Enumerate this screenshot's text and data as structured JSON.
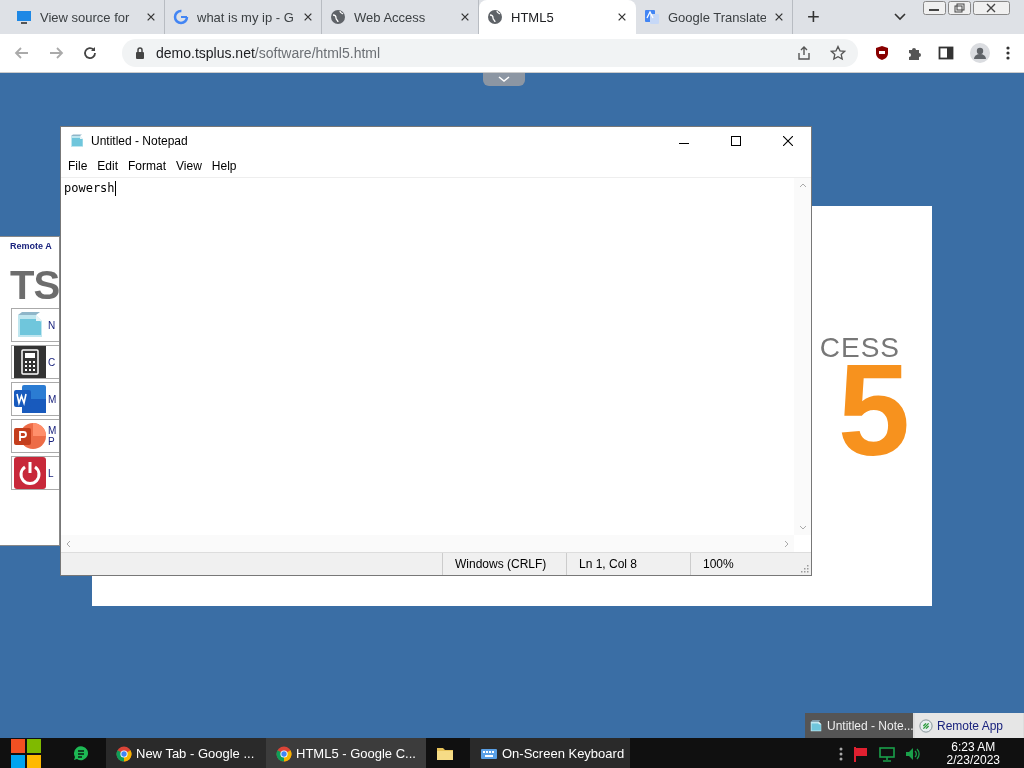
{
  "browser": {
    "tabs": [
      {
        "title": "View source for",
        "selected": false
      },
      {
        "title": "what is my ip - G",
        "selected": false
      },
      {
        "title": "Web Access",
        "selected": false
      },
      {
        "title": "HTML5",
        "selected": true
      },
      {
        "title": "Google Translate",
        "selected": false
      }
    ],
    "new_tab": "+",
    "address": {
      "host": "demo.tsplus.net",
      "path": "/software/html5.html"
    }
  },
  "remote_panel": {
    "title": "Remote A",
    "logo": "TS",
    "apps": [
      {
        "lines": [
          "N"
        ]
      },
      {
        "lines": [
          "C"
        ]
      },
      {
        "lines": [
          "M"
        ]
      },
      {
        "lines": [
          "M",
          "P"
        ]
      },
      {
        "lines": [
          "L"
        ]
      }
    ]
  },
  "background_logo": {
    "word": "CESS",
    "mark": "5"
  },
  "notepad": {
    "title": "Untitled - Notepad",
    "menu": [
      "File",
      "Edit",
      "Format",
      "View",
      "Help"
    ],
    "text": "powersh",
    "status": [
      "Windows (CRLF)",
      "Ln 1, Col 8",
      "100%"
    ]
  },
  "taskbar_popup": [
    {
      "label": "Untitled - Note...",
      "selected": true
    },
    {
      "label": "Remote App",
      "selected": false
    }
  ],
  "taskbar": {
    "items": [
      {
        "kind": "icon"
      },
      {
        "kind": "button",
        "label": "New Tab - Google ...",
        "selected": false
      },
      {
        "kind": "button",
        "label": "HTML5 - Google C...",
        "selected": true
      },
      {
        "kind": "icon"
      },
      {
        "kind": "button",
        "label": "On-Screen Keyboard",
        "selected": false
      }
    ],
    "clock": {
      "time": "6:23 AM",
      "date": "2/23/2023"
    }
  }
}
